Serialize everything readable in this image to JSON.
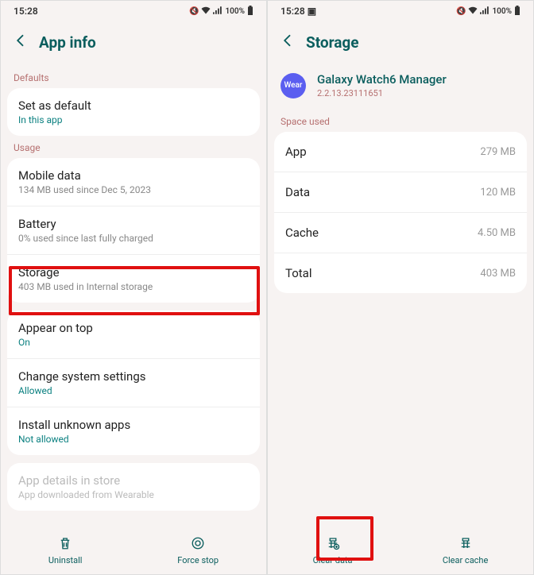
{
  "statusbar": {
    "time": "15:28",
    "battery": "100%"
  },
  "left": {
    "header": "App info",
    "sections": {
      "defaults": "Defaults",
      "usage": "Usage"
    },
    "setDefault": {
      "title": "Set as default",
      "sub": "In this app"
    },
    "mobileData": {
      "title": "Mobile data",
      "sub": "134 MB used since Dec 5, 2023"
    },
    "battery": {
      "title": "Battery",
      "sub": "0% used since last fully charged"
    },
    "storage": {
      "title": "Storage",
      "sub": "403 MB used in Internal storage"
    },
    "appearOnTop": {
      "title": "Appear on top",
      "sub": "On"
    },
    "changeSettings": {
      "title": "Change system settings",
      "sub": "Allowed"
    },
    "installUnknown": {
      "title": "Install unknown apps",
      "sub": "Not allowed"
    },
    "appDetails": {
      "title": "App details in store",
      "sub": "App downloaded from Wearable"
    },
    "bottom": {
      "uninstall": "Uninstall",
      "forceStop": "Force stop"
    }
  },
  "right": {
    "header": "Storage",
    "appIconText": "Wear",
    "appName": "Galaxy Watch6 Manager",
    "appVersion": "2.2.13.23111651",
    "spaceUsed": "Space used",
    "rows": {
      "app": {
        "label": "App",
        "value": "279 MB"
      },
      "data": {
        "label": "Data",
        "value": "120 MB"
      },
      "cache": {
        "label": "Cache",
        "value": "4.50 MB"
      },
      "total": {
        "label": "Total",
        "value": "403 MB"
      }
    },
    "bottom": {
      "clearData": "Clear data",
      "clearCache": "Clear cache"
    }
  }
}
